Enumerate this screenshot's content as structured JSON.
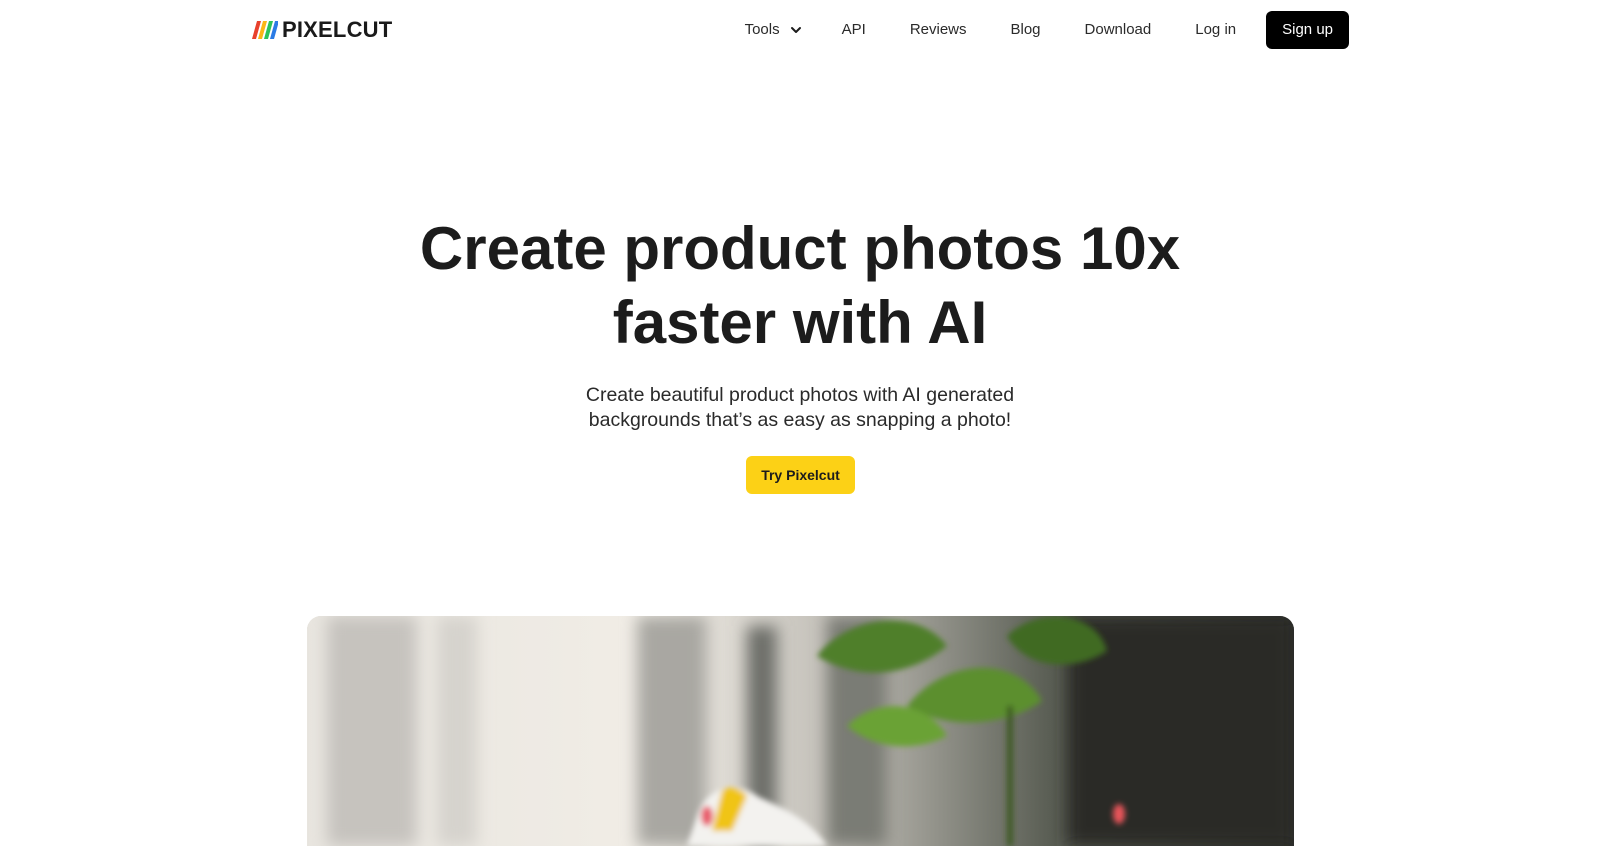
{
  "brand": {
    "name": "PIXELCUT",
    "logo_colors": [
      "#e8412c",
      "#fcb616",
      "#2ec35a",
      "#2b7be5"
    ]
  },
  "nav": {
    "tools_label": "Tools",
    "api_label": "API",
    "reviews_label": "Reviews",
    "blog_label": "Blog",
    "download_label": "Download",
    "login_label": "Log in",
    "signup_label": "Sign up"
  },
  "hero": {
    "title_line1": "Create product photos 10x",
    "title_line2": "faster with AI",
    "subtitle_line1": "Create beautiful product photos with AI generated",
    "subtitle_line2": "backgrounds that’s as easy as snapping a photo!",
    "cta_label": "Try Pixelcut"
  },
  "colors": {
    "cta_bg": "#fcd116",
    "signup_bg": "#000000",
    "text": "#1c1c1c"
  }
}
